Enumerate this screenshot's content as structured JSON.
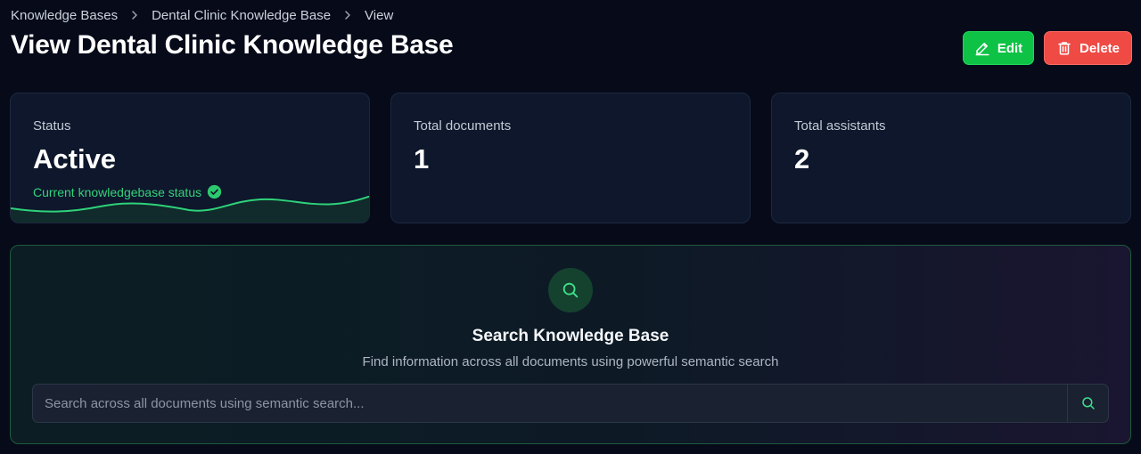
{
  "breadcrumb": {
    "items": [
      "Knowledge Bases",
      "Dental Clinic Knowledge Base",
      "View"
    ]
  },
  "header": {
    "title": "View Dental Clinic Knowledge Base",
    "edit_label": "Edit",
    "delete_label": "Delete"
  },
  "stats": [
    {
      "label": "Status",
      "value": "Active",
      "description": "Current knowledgebase status"
    },
    {
      "label": "Total documents",
      "value": "1"
    },
    {
      "label": "Total assistants",
      "value": "2"
    }
  ],
  "search": {
    "title": "Search Knowledge Base",
    "subtitle": "Find information across all documents using powerful semantic search",
    "placeholder": "Search across all documents using semantic search...",
    "value": ""
  },
  "icons": {
    "breadcrumb_separator": "chevron-right-icon",
    "edit": "pencil-icon",
    "delete": "trash-icon",
    "status_check": "check-circle-icon",
    "search": "search-icon"
  },
  "colors": {
    "background": "#060a19",
    "card": "#0e172b",
    "accent_green": "#0ec245",
    "danger_red": "#ef4a44",
    "status_green": "#34d27c"
  }
}
